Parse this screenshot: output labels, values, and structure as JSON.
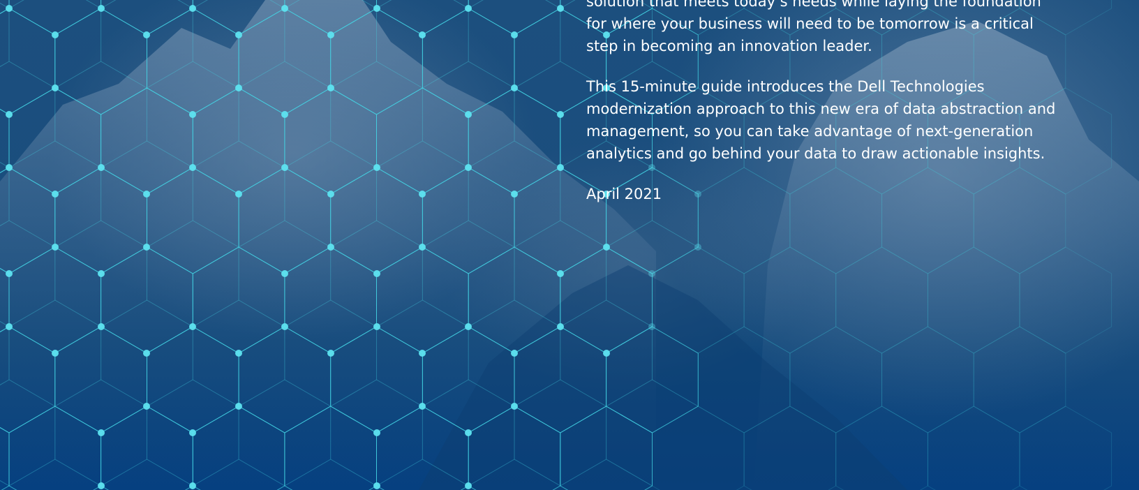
{
  "intro": {
    "paragraph_1": "solution that meets today’s needs while laying the foundation for where your business will need to be tomorrow is a critical step in becoming an innovation leader.",
    "paragraph_2": "This 15-minute guide introduces the Dell Technologies modernization approach to this new era of data abstraction and management, so you can take advantage of next-generation analytics and go behind your data to draw actionable insights.",
    "date": "April 2021"
  },
  "colors": {
    "background_top": "#1c4f7e",
    "background_bottom": "#064080",
    "hex_line": "#45d6e6",
    "hex_node": "#5ee3f0",
    "text": "#ffffff"
  }
}
